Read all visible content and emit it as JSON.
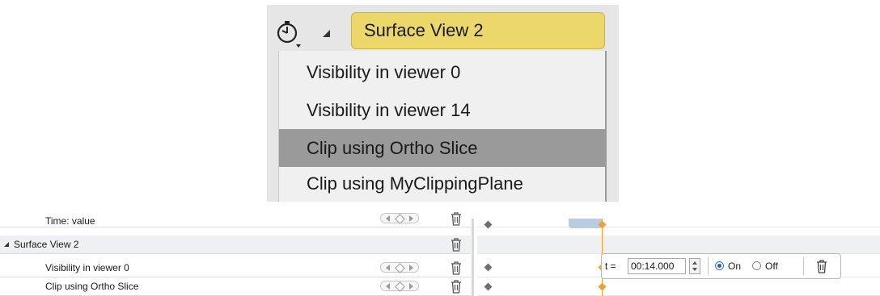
{
  "zoom": {
    "title": "Surface View 2",
    "menu": [
      {
        "label": "Visibility in viewer 0",
        "selected": false
      },
      {
        "label": "Visibility in viewer 14",
        "selected": false
      },
      {
        "label": "Clip using Ortho Slice",
        "selected": true
      },
      {
        "label": "Clip using MyClippingPlane",
        "selected": false
      }
    ]
  },
  "tracks": {
    "rows": [
      {
        "label": "Time: value"
      },
      {
        "label": "Surface View 2"
      },
      {
        "label": "Visibility in viewer 0"
      },
      {
        "label": "Clip using Ortho Slice"
      }
    ]
  },
  "editor": {
    "t_label": "t =",
    "time_value": "00:14.000",
    "on_label": "On",
    "off_label": "Off",
    "state": "On"
  },
  "colors": {
    "title_field": "#ecd86a",
    "selected_item": "#9a9a9a",
    "keyframe": "#f0a030",
    "timeline_cursor": "#f0a030"
  }
}
